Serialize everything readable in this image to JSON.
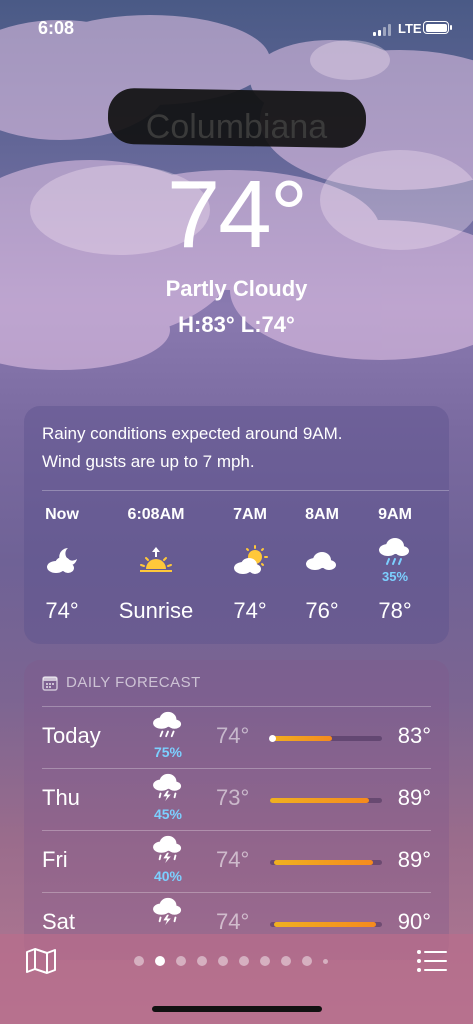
{
  "status_bar": {
    "time": "6:08",
    "network": "LTE"
  },
  "location": {
    "city": "Columbiana"
  },
  "current": {
    "temperature": "74°",
    "condition": "Partly Cloudy",
    "high_low": "H:83°  L:74°"
  },
  "hourly": {
    "summary_line1": "Rainy conditions expected around 9AM.",
    "summary_line2": "Wind gusts are up to 7 mph.",
    "items": [
      {
        "label": "Now",
        "icon": "moon-cloud-icon",
        "value": "74°"
      },
      {
        "label": "6:08AM",
        "icon": "sunrise-icon",
        "value": "Sunrise"
      },
      {
        "label": "7AM",
        "icon": "sun-cloud-icon",
        "value": "74°"
      },
      {
        "label": "8AM",
        "icon": "cloud-icon",
        "value": "76°"
      },
      {
        "label": "9AM",
        "icon": "rain-cloud-icon",
        "precip": "35%",
        "value": "78°"
      }
    ]
  },
  "daily": {
    "header": "DAILY FORECAST",
    "items": [
      {
        "day": "Today",
        "icon": "rain-cloud-icon",
        "precip": "75%",
        "low": "74°",
        "high": "83°",
        "range_start": 0.0,
        "range_end": 0.55,
        "current_marker": 0.02
      },
      {
        "day": "Thu",
        "icon": "thunderstorm-icon",
        "precip": "45%",
        "low": "73°",
        "high": "89°",
        "range_start": 0.0,
        "range_end": 0.88
      },
      {
        "day": "Fri",
        "icon": "thunderstorm-icon",
        "precip": "40%",
        "low": "74°",
        "high": "89°",
        "range_start": 0.04,
        "range_end": 0.92
      },
      {
        "day": "Sat",
        "icon": "thunderstorm-icon",
        "precip": "",
        "low": "74°",
        "high": "90°",
        "range_start": 0.04,
        "range_end": 0.95
      }
    ]
  },
  "pager": {
    "count": 10,
    "active": 1
  },
  "colors": {
    "precip": "#7cd0ff",
    "sun": "#ffc83a",
    "bar_start": "#f0b020",
    "bar_end": "#f58a1e"
  }
}
